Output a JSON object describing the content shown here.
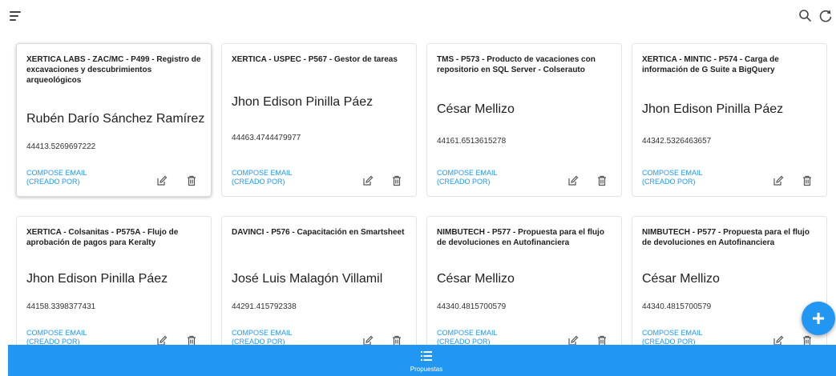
{
  "header": {
    "menu_icon": "filter-list-icon",
    "search_icon": "search-icon",
    "refresh_icon": "refresh-icon"
  },
  "cards": [
    {
      "title": "XERTICA LABS - ZAC/MC - P499 - Registro de excavaciones y descubrimientos arqueológicos",
      "name": "Rubén Darío Sánchez Ramírez",
      "number": "44413.5269697222",
      "link_line1": "COMPOSE EMAIL",
      "link_line2": "(CREADO POR)"
    },
    {
      "title": "XERTICA - USPEC - P567 - Gestor de tareas",
      "name": "Jhon Edison Pinilla Páez",
      "number": "44463.4744479977",
      "link_line1": "COMPOSE EMAIL",
      "link_line2": "(CREADO POR)"
    },
    {
      "title": "TMS - P573 - Producto de vacaciones con repositorio en SQL Server - Colserauto",
      "name": "César Mellizo",
      "number": "44161.6513615278",
      "link_line1": "COMPOSE EMAIL",
      "link_line2": "(CREADO POR)"
    },
    {
      "title": "XERTICA - MINTIC - P574 - Carga de información de G Suite a BigQuery",
      "name": "Jhon Edison Pinilla Páez",
      "number": "44342.5326463657",
      "link_line1": "COMPOSE EMAIL",
      "link_line2": "(CREADO POR)"
    },
    {
      "title": "XERTICA - Colsanitas - P575A - Flujo de aprobación de pagos para Keralty",
      "name": "Jhon Edison Pinilla Páez",
      "number": "44158.3398377431",
      "link_line1": "COMPOSE EMAIL",
      "link_line2": "(CREADO POR)"
    },
    {
      "title": "DAVINCI - P576 - Capacitación en Smartsheet",
      "name": "José Luis Malagón Villamil",
      "number": "44291.415792338",
      "link_line1": "COMPOSE EMAIL",
      "link_line2": "(CREADO POR)"
    },
    {
      "title": "NIMBUTECH - P577 - Propuesta para el flujo de devoluciones en Autofinanciera",
      "name": "César Mellizo",
      "number": "44340.4815700579",
      "link_line1": "COMPOSE EMAIL",
      "link_line2": "(CREADO POR)"
    },
    {
      "title": "NIMBUTECH - P577 - Propuesta para el flujo de devoluciones en Autofinanciera",
      "name": "César Mellizo",
      "number": "44340.4815700579",
      "link_line1": "COMPOSE EMAIL",
      "link_line2": "(CREADO POR)"
    }
  ],
  "card_actions": {
    "edit_icon": "edit-icon",
    "delete_icon": "trash-icon"
  },
  "bottom_nav": {
    "label": "Propuestas",
    "icon": "list-icon"
  },
  "fab": {
    "label": "+",
    "icon": "add-icon"
  },
  "colors": {
    "accent": "#2196f3",
    "text": "#212121"
  }
}
